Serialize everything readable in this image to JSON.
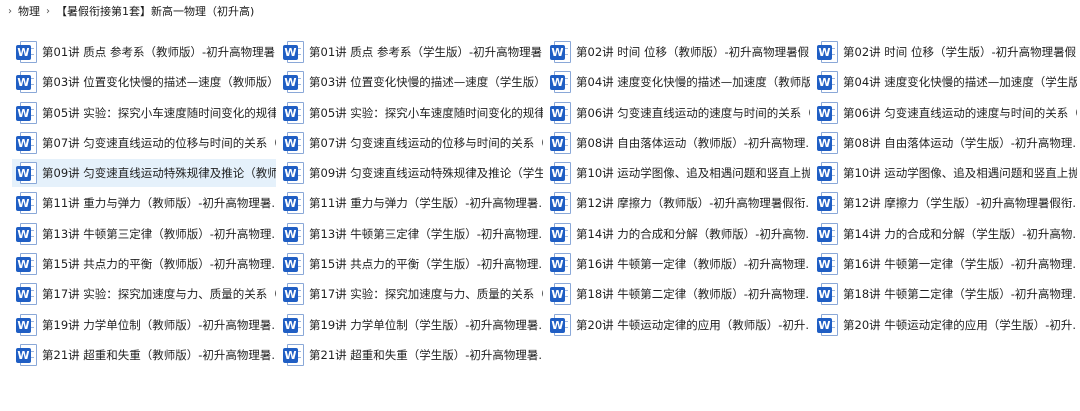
{
  "breadcrumb": {
    "items": [
      "物理",
      "【暑假衔接第1套】新高一物理（初升高)"
    ]
  },
  "icon": {
    "name": "word-doc-icon",
    "letter": "W",
    "color": "#1f5ec4"
  },
  "selected_index": 16,
  "files": [
    "第01讲 质点 参考系（教师版）-初升高物理暑...",
    "第01讲 质点 参考系（学生版）-初升高物理暑...",
    "第02讲 时间 位移（教师版）-初升高物理暑假...",
    "第02讲 时间 位移（学生版）-初升高物理暑假...",
    "第03讲 位置变化快慢的描述—速度（教师版）...",
    "第03讲 位置变化快慢的描述—速度（学生版）...",
    "第04讲 速度变化快慢的描述—加速度（教师版...",
    "第04讲 速度变化快慢的描述—加速度（学生版...",
    "第05讲 实验：探究小车速度随时间变化的规律...",
    "第05讲 实验：探究小车速度随时间变化的规律...",
    "第06讲 匀变速直线运动的速度与时间的关系（...",
    "第06讲 匀变速直线运动的速度与时间的关系（...",
    "第07讲 匀变速直线运动的位移与时间的关系（...",
    "第07讲 匀变速直线运动的位移与时间的关系（...",
    "第08讲 自由落体运动（教师版）-初升高物理...",
    "第08讲 自由落体运动（学生版）-初升高物理...",
    "第09讲 匀变速直线运动特殊规律及推论（教师...",
    "第09讲 匀变速直线运动特殊规律及推论（学生...",
    "第10讲 运动学图像、追及相遇问题和竖直上抛...",
    "第10讲 运动学图像、追及相遇问题和竖直上抛...",
    "第11讲 重力与弹力（教师版）-初升高物理暑...",
    "第11讲 重力与弹力（学生版）-初升高物理暑...",
    "第12讲 摩擦力（教师版）-初升高物理暑假衔...",
    "第12讲 摩擦力（学生版）-初升高物理暑假衔...",
    "第13讲 牛顿第三定律（教师版）-初升高物理...",
    "第13讲 牛顿第三定律（学生版）-初升高物理...",
    "第14讲 力的合成和分解（教师版）-初升高物...",
    "第14讲 力的合成和分解（学生版）-初升高物...",
    "第15讲 共点力的平衡（教师版）-初升高物理...",
    "第15讲 共点力的平衡（学生版）-初升高物理...",
    "第16讲 牛顿第一定律（教师版）-初升高物理...",
    "第16讲 牛顿第一定律（学生版）-初升高物理...",
    "第17讲 实验：探究加速度与力、质量的关系（...",
    "第17讲 实验：探究加速度与力、质量的关系（...",
    "第18讲 牛顿第二定律（教师版）-初升高物理...",
    "第18讲 牛顿第二定律（学生版）-初升高物理...",
    "第19讲 力学单位制（教师版）-初升高物理暑...",
    "第19讲 力学单位制（学生版）-初升高物理暑...",
    "第20讲 牛顿运动定律的应用（教师版）-初升...",
    "第20讲 牛顿运动定律的应用（学生版）-初升...",
    "第21讲 超重和失重（教师版）-初升高物理暑...",
    "第21讲 超重和失重（学生版）-初升高物理暑..."
  ]
}
